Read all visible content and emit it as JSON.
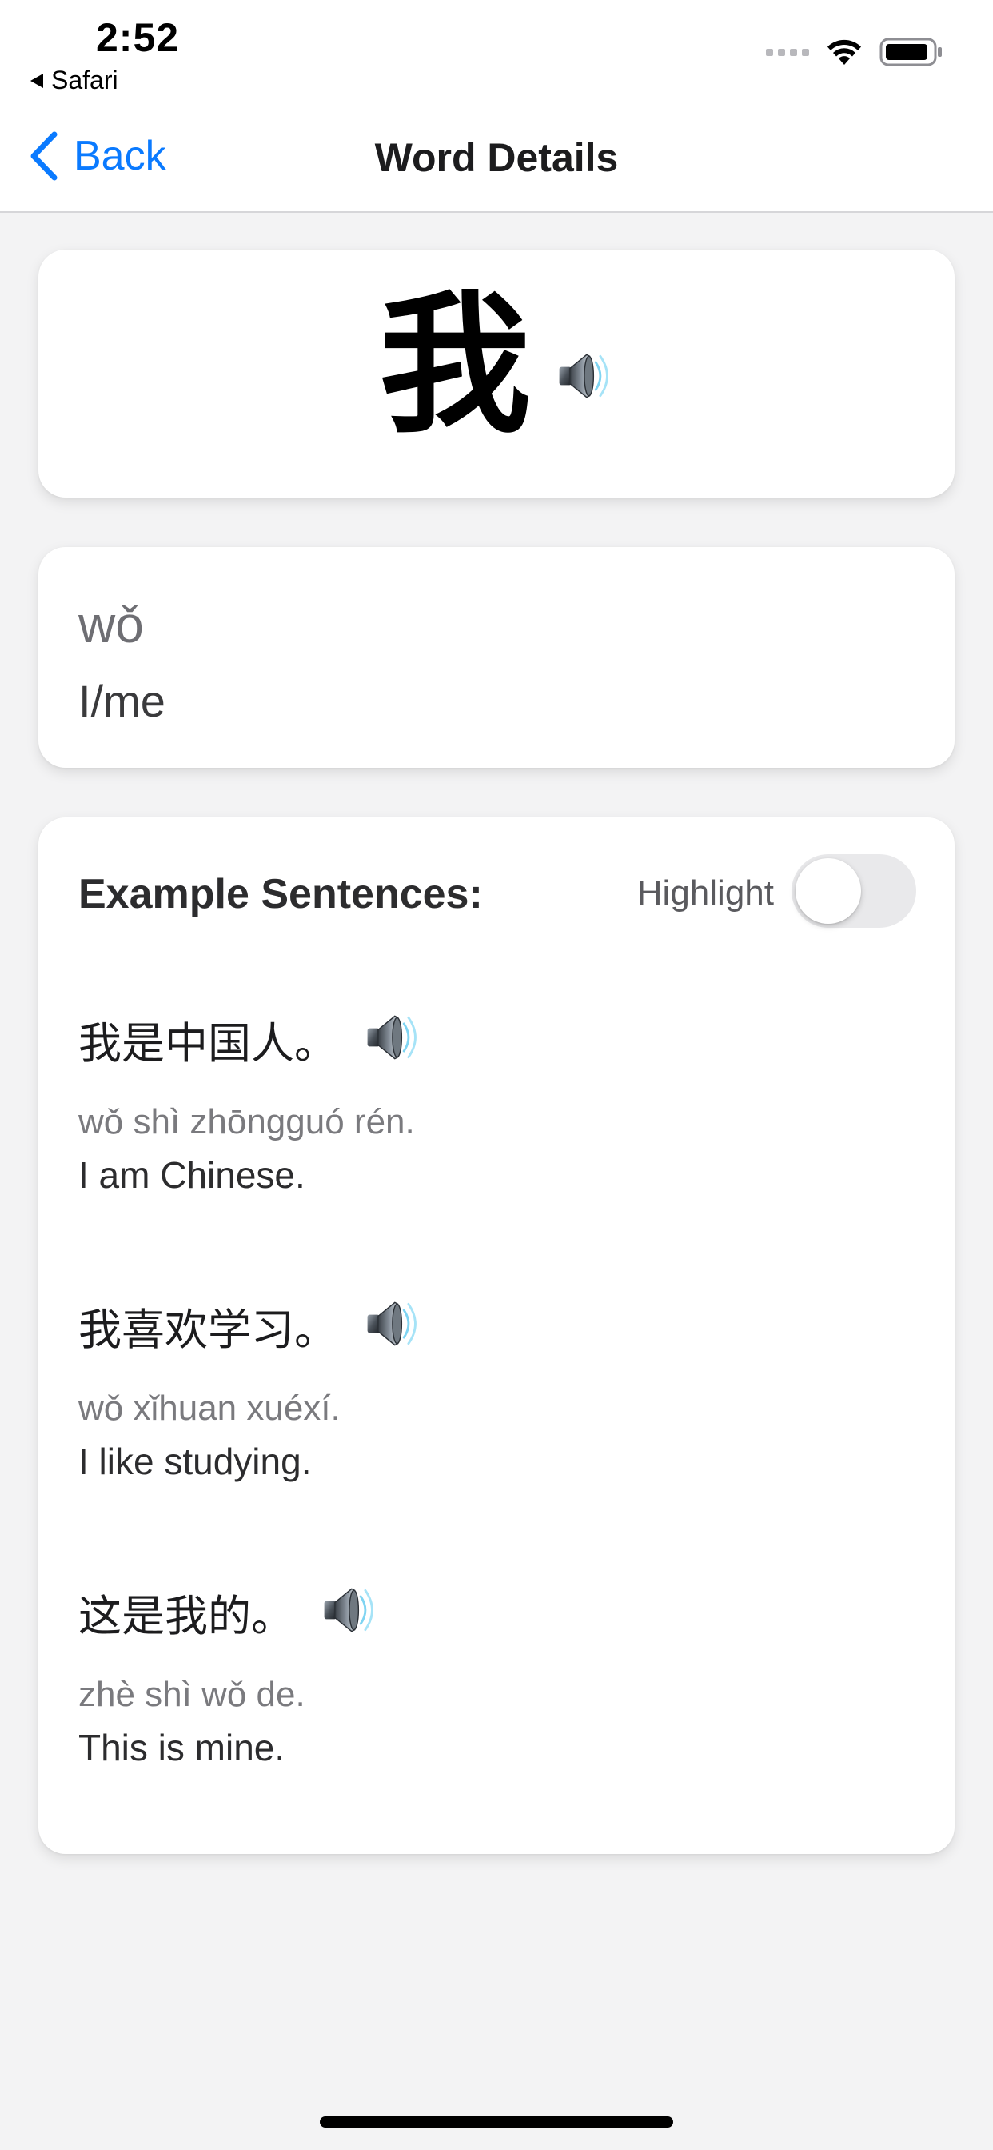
{
  "status_bar": {
    "time": "2:52",
    "back_app": "Safari"
  },
  "nav": {
    "back_label": "Back",
    "title": "Word Details"
  },
  "word": {
    "character": "我",
    "pinyin": "wǒ",
    "meaning": "I/me"
  },
  "examples": {
    "heading": "Example Sentences:",
    "highlight_label": "Highlight",
    "highlight_on": false,
    "items": [
      {
        "hanzi": "我是中国人。",
        "pinyin": "wǒ shì zhōngguó rén.",
        "english": "I am Chinese."
      },
      {
        "hanzi": "我喜欢学习。",
        "pinyin": "wǒ xǐhuan xuéxí.",
        "english": "I like studying."
      },
      {
        "hanzi": "这是我的。",
        "pinyin": "zhè shì wǒ de.",
        "english": "This is mine."
      }
    ]
  },
  "colors": {
    "accent": "#0a7aff",
    "background": "#f3f3f4",
    "card": "#ffffff"
  },
  "icons": [
    "back-chevron-icon",
    "speaker-icon",
    "wifi-icon",
    "battery-icon",
    "cellular-signal-icon"
  ]
}
